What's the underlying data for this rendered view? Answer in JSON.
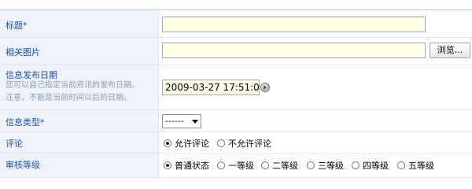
{
  "fields": {
    "title": {
      "label": "标题",
      "required_mark": "*",
      "value": ""
    },
    "image": {
      "label": "相关图片",
      "value": "",
      "browse_label": "浏览..."
    },
    "publish_date": {
      "label": "信息发布日期",
      "hint_line1": "您可以自己指定当前资讯的发布日期。",
      "hint_line2": "注意，不能是当前时间以后的日期。",
      "value": "2009-03-27 17:51:08"
    },
    "info_type": {
      "label": "信息类型",
      "required_mark": "*",
      "selected": "------"
    },
    "comment": {
      "label": "评论",
      "options": [
        {
          "label": "允许评论",
          "checked": true
        },
        {
          "label": "不允许评论",
          "checked": false
        }
      ]
    },
    "review_level": {
      "label": "审核等级",
      "options": [
        {
          "label": "普通状态",
          "checked": true
        },
        {
          "label": "一等级",
          "checked": false
        },
        {
          "label": "二等级",
          "checked": false
        },
        {
          "label": "三等级",
          "checked": false
        },
        {
          "label": "四等级",
          "checked": false
        },
        {
          "label": "五等级",
          "checked": false
        }
      ]
    }
  },
  "colors": {
    "label_bg": "#eef3fa",
    "label_text": "#1d4f9a",
    "input_bg": "#fffde6"
  }
}
